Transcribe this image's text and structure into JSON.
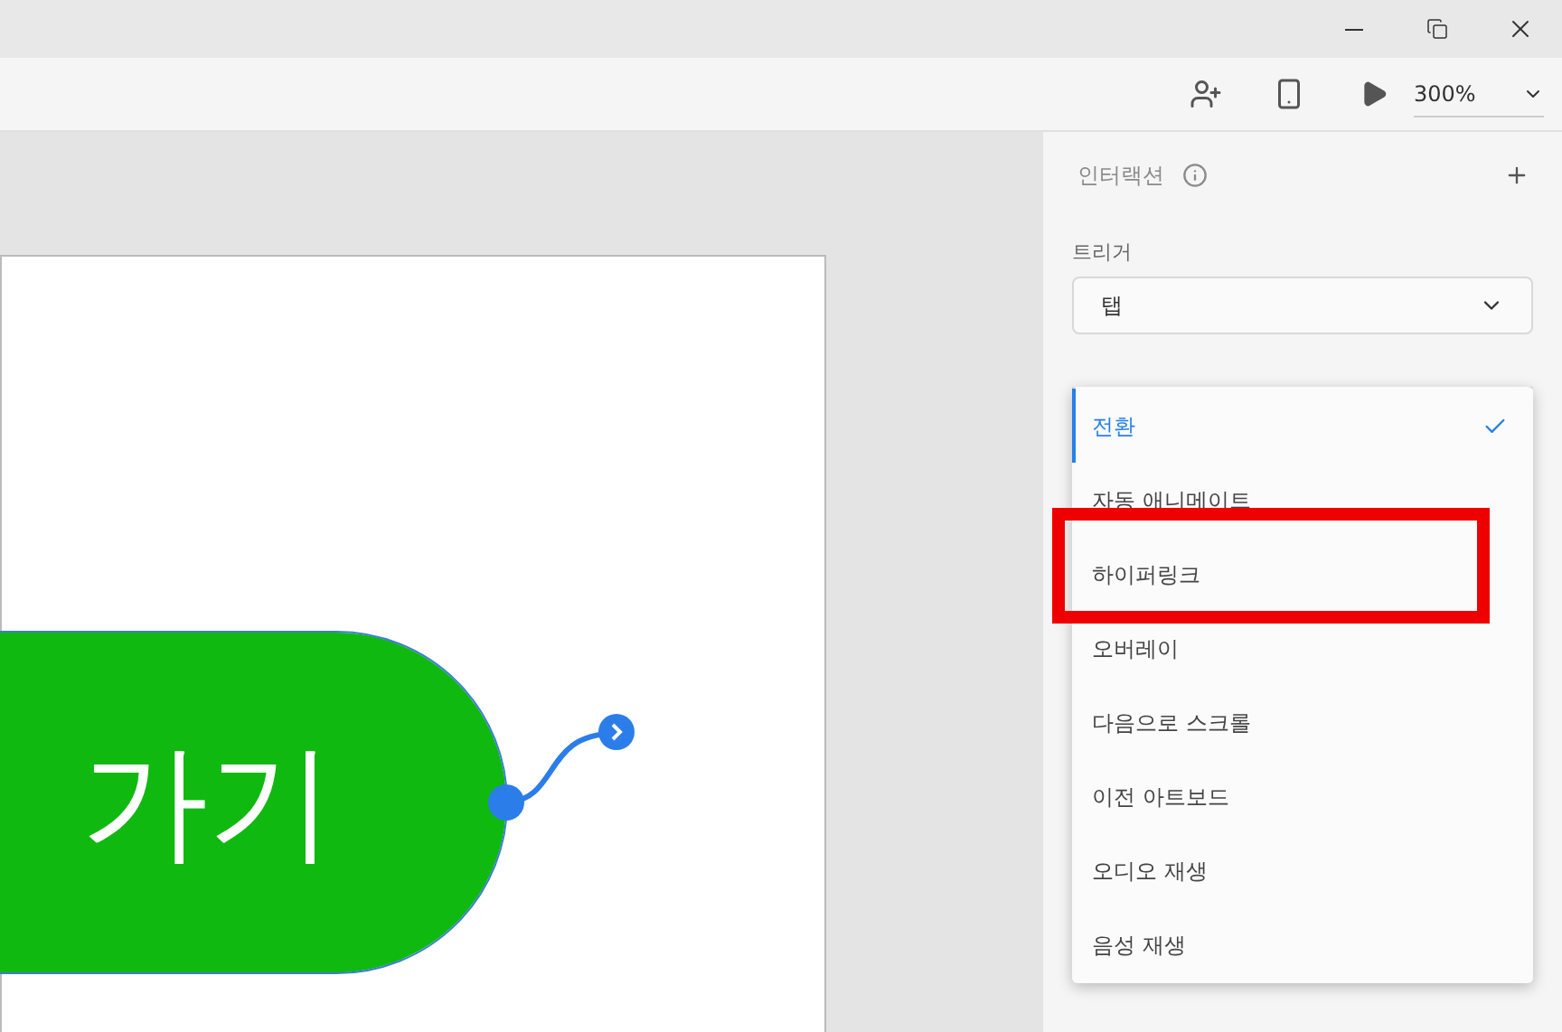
{
  "toolbar": {
    "zoom": "300%"
  },
  "canvas": {
    "button_text": "가기"
  },
  "panel": {
    "title": "인터랙션",
    "trigger_label": "트리거",
    "trigger_value": "탭"
  },
  "action_menu": [
    {
      "label": "전환",
      "selected": true,
      "highlighted": false
    },
    {
      "label": "자동 애니메이트",
      "selected": false,
      "highlighted": false
    },
    {
      "label": "하이퍼링크",
      "selected": false,
      "highlighted": true
    },
    {
      "label": "오버레이",
      "selected": false,
      "highlighted": false
    },
    {
      "label": "다음으로 스크롤",
      "selected": false,
      "highlighted": false
    },
    {
      "label": "이전 아트보드",
      "selected": false,
      "highlighted": false
    },
    {
      "label": "오디오 재생",
      "selected": false,
      "highlighted": false
    },
    {
      "label": "음성 재생",
      "selected": false,
      "highlighted": false
    }
  ]
}
